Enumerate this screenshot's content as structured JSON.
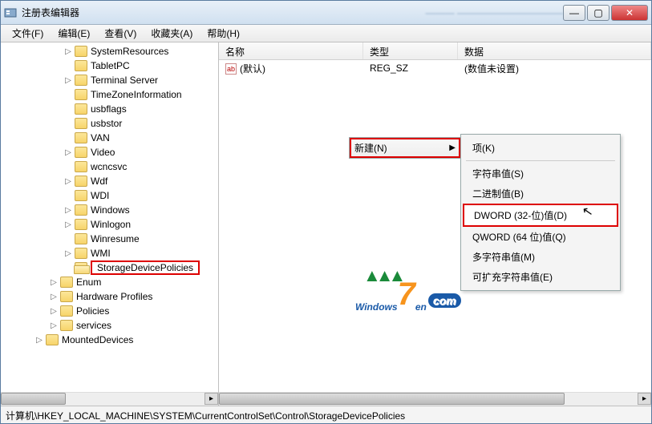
{
  "window": {
    "title": "注册表编辑器",
    "blurred_suffix": "——— ———————————"
  },
  "menu": {
    "file": "文件(F)",
    "edit": "编辑(E)",
    "view": "查看(V)",
    "favorites": "收藏夹(A)",
    "help": "帮助(H)"
  },
  "tree": {
    "items": [
      {
        "indent": 3,
        "tw": "▷",
        "label": "SystemResources"
      },
      {
        "indent": 3,
        "tw": "",
        "label": "TabletPC"
      },
      {
        "indent": 3,
        "tw": "▷",
        "label": "Terminal Server"
      },
      {
        "indent": 3,
        "tw": "",
        "label": "TimeZoneInformation"
      },
      {
        "indent": 3,
        "tw": "",
        "label": "usbflags"
      },
      {
        "indent": 3,
        "tw": "",
        "label": "usbstor"
      },
      {
        "indent": 3,
        "tw": "",
        "label": "VAN"
      },
      {
        "indent": 3,
        "tw": "▷",
        "label": "Video"
      },
      {
        "indent": 3,
        "tw": "",
        "label": "wcncsvc"
      },
      {
        "indent": 3,
        "tw": "▷",
        "label": "Wdf"
      },
      {
        "indent": 3,
        "tw": "",
        "label": "WDI"
      },
      {
        "indent": 3,
        "tw": "▷",
        "label": "Windows"
      },
      {
        "indent": 3,
        "tw": "▷",
        "label": "Winlogon"
      },
      {
        "indent": 3,
        "tw": "",
        "label": "Winresume"
      },
      {
        "indent": 3,
        "tw": "▷",
        "label": "WMI"
      },
      {
        "indent": 3,
        "tw": "",
        "label": "StorageDevicePolicies",
        "selected": true,
        "open": true
      },
      {
        "indent": 2,
        "tw": "▷",
        "label": "Enum"
      },
      {
        "indent": 2,
        "tw": "▷",
        "label": "Hardware Profiles"
      },
      {
        "indent": 2,
        "tw": "▷",
        "label": "Policies"
      },
      {
        "indent": 2,
        "tw": "▷",
        "label": "services"
      },
      {
        "indent": 1,
        "tw": "▷",
        "label": "MountedDevices"
      }
    ]
  },
  "list": {
    "headers": {
      "name": "名称",
      "type": "类型",
      "data": "数据"
    },
    "rows": [
      {
        "icon": "ab",
        "name": "(默认)",
        "type": "REG_SZ",
        "data": "(数值未设置)"
      }
    ]
  },
  "context": {
    "new_label": "新建(N)",
    "sub": {
      "key": "项(K)",
      "string": "字符串值(S)",
      "binary": "二进制值(B)",
      "dword": "DWORD (32-位)值(D)",
      "qword": "QWORD (64 位)值(Q)",
      "multi": "多字符串值(M)",
      "expand": "可扩充字符串值(E)"
    }
  },
  "statusbar": "计算机\\HKEY_LOCAL_MACHINE\\SYSTEM\\CurrentControlSet\\Control\\StorageDevicePolicies",
  "watermark": {
    "prefix": "Windows",
    "seven": "7",
    "suffix": "en",
    "roof": "▲▲▲",
    "dotcom": "com"
  }
}
